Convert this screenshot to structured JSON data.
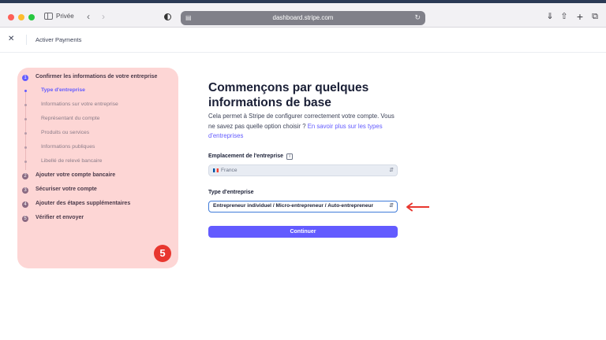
{
  "browser": {
    "private_label": "Privée",
    "url": "dashboard.stripe.com",
    "back_icon": "chevron-left-icon",
    "forward_icon": "chevron-right-icon"
  },
  "app_bar": {
    "title": "Activer Payments"
  },
  "steps": [
    {
      "number": "1",
      "label": "Confirmer les informations de votre entreprise",
      "active": true
    },
    {
      "number": "2",
      "label": "Ajouter votre compte bancaire",
      "active": false
    },
    {
      "number": "3",
      "label": "Sécuriser votre compte",
      "active": false
    },
    {
      "number": "4",
      "label": "Ajouter des étapes supplémentaires",
      "active": false
    },
    {
      "number": "5",
      "label": "Vérifier et envoyer",
      "active": false
    }
  ],
  "substeps": [
    {
      "label": "Type d'entreprise",
      "active": true
    },
    {
      "label": "Informations sur votre entreprise",
      "active": false
    },
    {
      "label": "Représentant du compte",
      "active": false
    },
    {
      "label": "Produits ou services",
      "active": false
    },
    {
      "label": "Informations publiques",
      "active": false
    },
    {
      "label": "Libellé de relevé bancaire",
      "active": false
    }
  ],
  "annotation_badge": "5",
  "form": {
    "heading": "Commençons par quelques informations de base",
    "description": "Cela permet à Stripe de configurer correctement votre compte. Vous ne savez pas quelle option choisir ?",
    "description_link": "En savoir plus sur les types d'entreprises",
    "location_label": "Emplacement de l'entreprise",
    "location_value": "France",
    "type_label": "Type d'entreprise",
    "type_value": "Entrepreneur individuel / Micro-entrepreneur / Auto-entrepreneur",
    "continue_label": "Continuer"
  },
  "colors": {
    "accent": "#635bff",
    "panel_highlight": "#fdd6d5",
    "annotation_red": "#e8372f"
  }
}
